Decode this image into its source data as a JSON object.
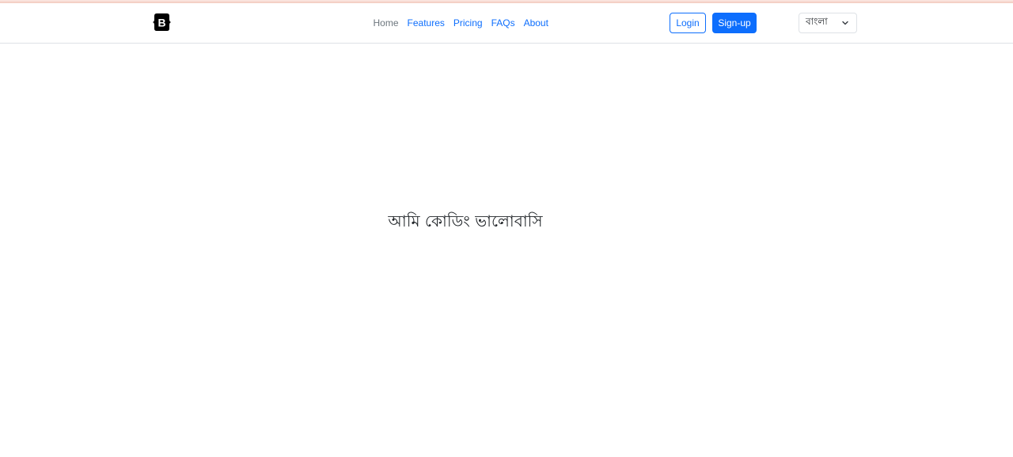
{
  "brand": {
    "logo_letter": "B",
    "logo_icon": "bootstrap-logo-icon"
  },
  "nav": {
    "items": [
      {
        "label": "Home",
        "active": true
      },
      {
        "label": "Features",
        "active": false
      },
      {
        "label": "Pricing",
        "active": false
      },
      {
        "label": "FAQs",
        "active": false
      },
      {
        "label": "About",
        "active": false
      }
    ]
  },
  "auth": {
    "login_label": "Login",
    "signup_label": "Sign-up"
  },
  "language": {
    "selected": "বাংলা",
    "icon": "chevron-down-icon"
  },
  "main": {
    "text": "আমি কোডিং ভালোবাসি"
  },
  "colors": {
    "primary": "#0d6efd",
    "muted": "#6c757d",
    "text": "#212529",
    "border": "#dee2e6",
    "logo": "#000000"
  }
}
